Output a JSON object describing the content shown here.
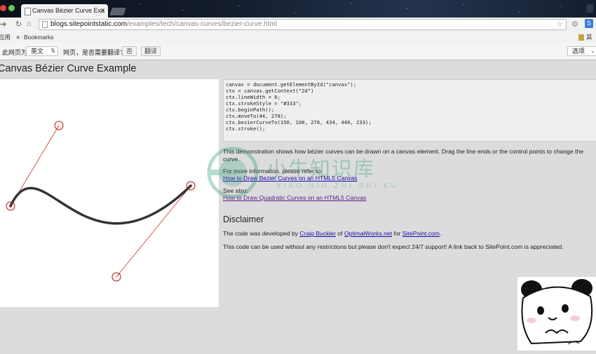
{
  "browser": {
    "tab_title": "Canvas Bézier Curve Exa",
    "url_host": "blogs.sitepointstatic.com",
    "url_path": "/examples/tech/canvas-curves/bezier-curve.html",
    "bookmarks": {
      "apps_label": "应用",
      "bookmarks_label": "Bookmarks",
      "other_label": "其他"
    }
  },
  "translate_bar": {
    "prefix": "此网页为",
    "language": "英文",
    "question": "网页，是否需要翻译?",
    "no_button": "否",
    "translate_button": "翻译",
    "options": "选项"
  },
  "page": {
    "title": "Canvas Bézier Curve Example",
    "code": "canvas = document.getElementById(\"canvas\");\nctx = canvas.getContext(\"2d\")\nctx.lineWidth = 6;\nctx.strokeStyle = \"#333\";\nctx.beginPath();\nctx.moveTo(44, 278);\nctx.bezierCurveTo(150, 100, 276, 434, 440, 233);\nctx.stroke();",
    "description": "This demonstration shows how bézier curves can be drawn on a canvas element. Drag the line ends or the control points to change the curve.",
    "more_info_label": "For more information, please refer to:",
    "link_bezier": "How to Draw Bezier Curves on an HTML5 Canvas",
    "see_also_label": "See also:",
    "link_quadratic": "How to Draw Quadratic Curves on an HTML5 Canvas",
    "disclaimer_heading": "Disclaimer",
    "credit_prefix": "The code was developed by ",
    "credit_author": "Craig Buckler",
    "credit_of": " of ",
    "credit_company": "OptimalWorks.net",
    "credit_for": " for ",
    "credit_site": "SitePoint.com",
    "credit_end": ".",
    "license_text": "This code can be used without any restrictions but please don't expect 24/7 support! A link back to SitePoint.com is appreciated."
  },
  "watermark": {
    "chinese": "小牛知识库",
    "pinyin": "XIAO NIU ZHI SHI KU"
  },
  "colors": {
    "curve": "#333333",
    "control_line": "#cc3333"
  }
}
